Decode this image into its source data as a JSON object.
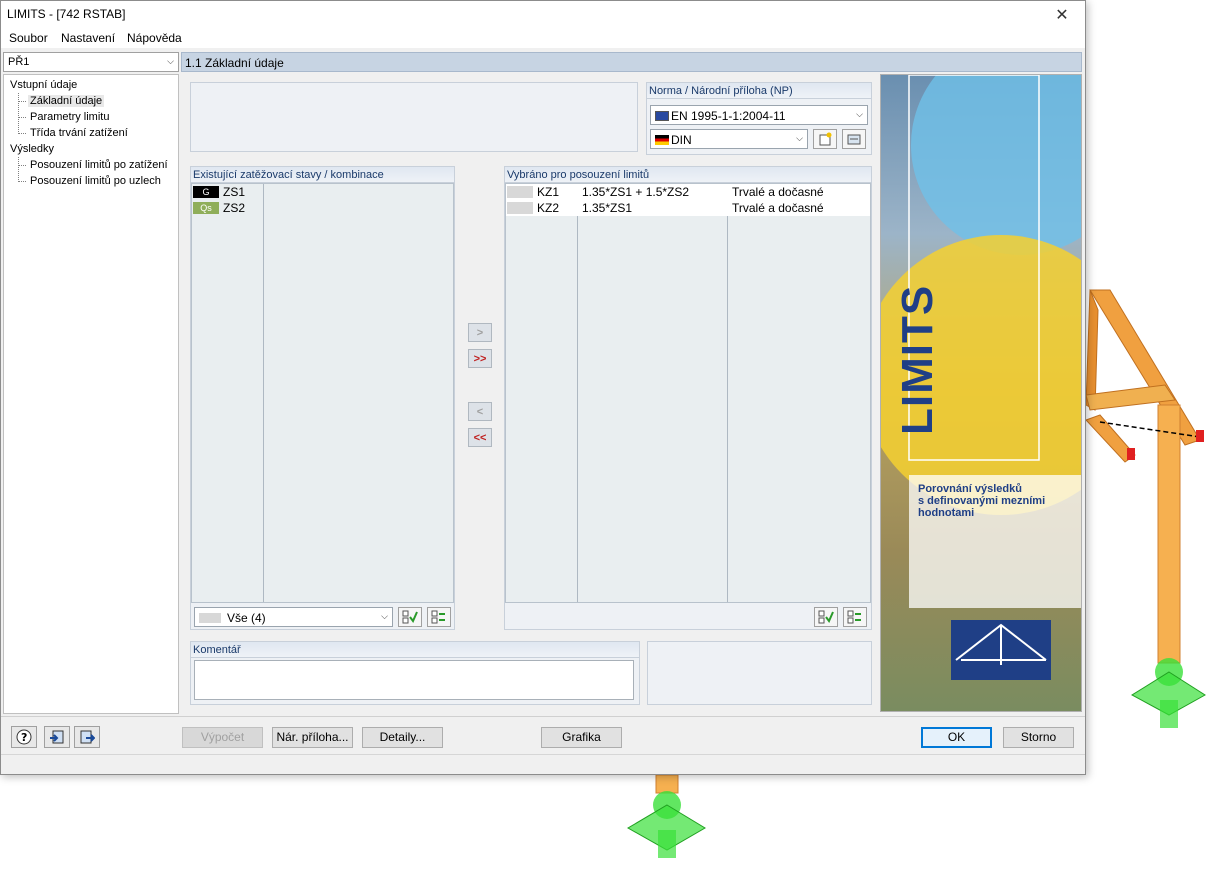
{
  "window": {
    "title": "LIMITS - [742 RSTAB]"
  },
  "menu": [
    "Soubor",
    "Nastavení",
    "Nápověda"
  ],
  "navigator": {
    "selected_case": "PŘ1",
    "tree": {
      "input_root": "Vstupní údaje",
      "input_items": [
        "Základní údaje",
        "Parametry limitu",
        "Třída trvání zatížení"
      ],
      "results_root": "Výsledky",
      "results_items": [
        "Posouzení limitů po zatížení",
        "Posouzení limitů po uzlech"
      ]
    }
  },
  "main": {
    "header": "1.1 Základní údaje",
    "norm": {
      "title": "Norma / Národní příloha (NP)",
      "standard": "EN 1995-1-1:2004-11",
      "annex": "DIN"
    },
    "existing": {
      "title": "Existující zatěžovací stavy /  kombinace",
      "rows": [
        {
          "badge": "G",
          "badge_bg": "#000000",
          "badge_fg": "#ffffff",
          "name": "ZS1"
        },
        {
          "badge": "Qs",
          "badge_bg": "#8fae5a",
          "badge_fg": "#ffffff",
          "name": "ZS2"
        }
      ],
      "filter": "Vše (4)"
    },
    "selected": {
      "title": "Vybráno pro posouzení limitů",
      "rows": [
        {
          "name": "KZ1",
          "formula": "1.35*ZS1 + 1.5*ZS2",
          "duration": "Trvalé a dočasné"
        },
        {
          "name": "KZ2",
          "formula": "1.35*ZS1",
          "duration": "Trvalé a dočasné"
        }
      ]
    },
    "transfer_buttons": [
      ">",
      ">>",
      "<",
      "<<"
    ],
    "comment": {
      "title": "Komentář",
      "value": ""
    }
  },
  "logo": {
    "product": "LIMITS",
    "tagline_1": "Porovnání výsledků",
    "tagline_2": "s definovanými mezními",
    "tagline_3": "hodnotami"
  },
  "buttons": {
    "calculate": "Výpočet",
    "annex": "Nár. příloha...",
    "details": "Detaily...",
    "graphics": "Grafika",
    "ok": "OK",
    "cancel": "Storno"
  },
  "colors": {
    "header_bg": "#c7d4e3",
    "panel_title": "#1a3a6a",
    "limits_blue": "#1f3f86",
    "model_orange": "#f0a040",
    "support_green": "#39e039"
  }
}
